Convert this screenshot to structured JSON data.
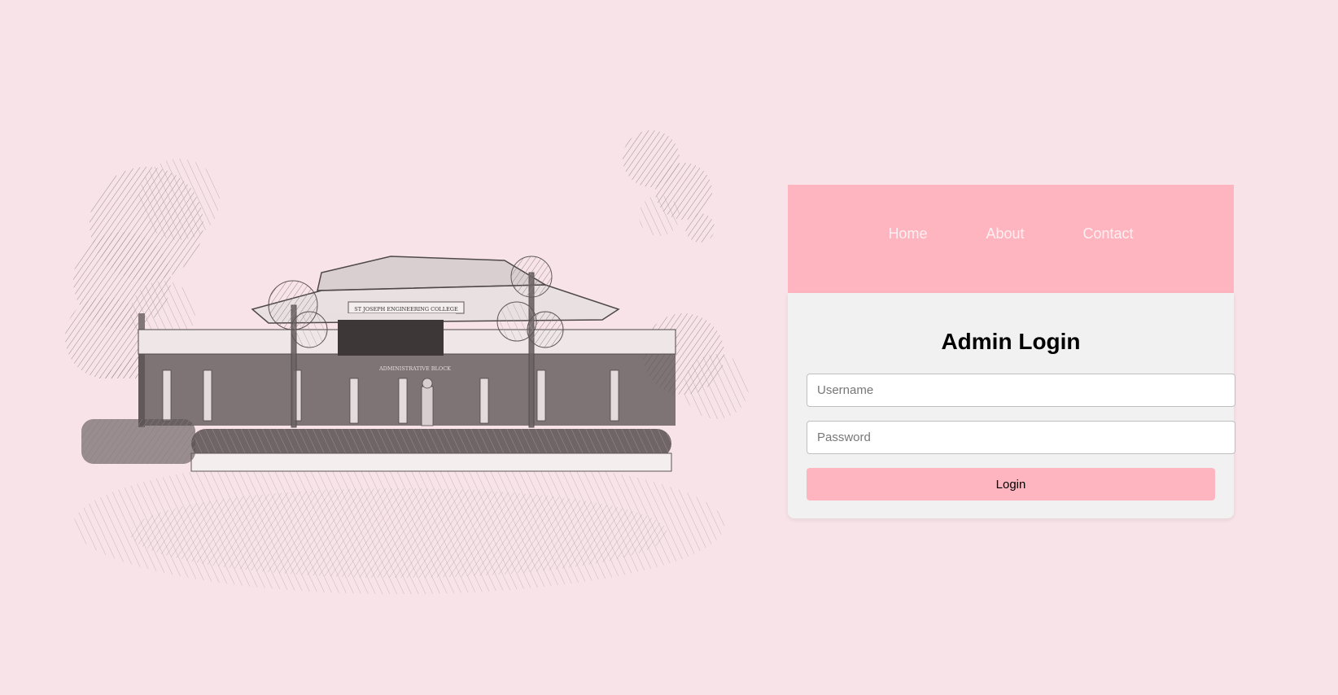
{
  "nav": {
    "items": [
      {
        "label": "Home"
      },
      {
        "label": "About"
      },
      {
        "label": "Contact"
      }
    ]
  },
  "login": {
    "title": "Admin Login",
    "username_placeholder": "Username",
    "password_placeholder": "Password",
    "button_label": "Login"
  },
  "illustration": {
    "icon": "college-building-sketch",
    "building_sign": "ST JOSEPH ENGINEERING COLLEGE",
    "block_sign": "ADMINISTRATIVE BLOCK"
  },
  "colors": {
    "background": "#f8e4e8",
    "accent": "#ffb5c0",
    "card": "#f1f1f1"
  }
}
